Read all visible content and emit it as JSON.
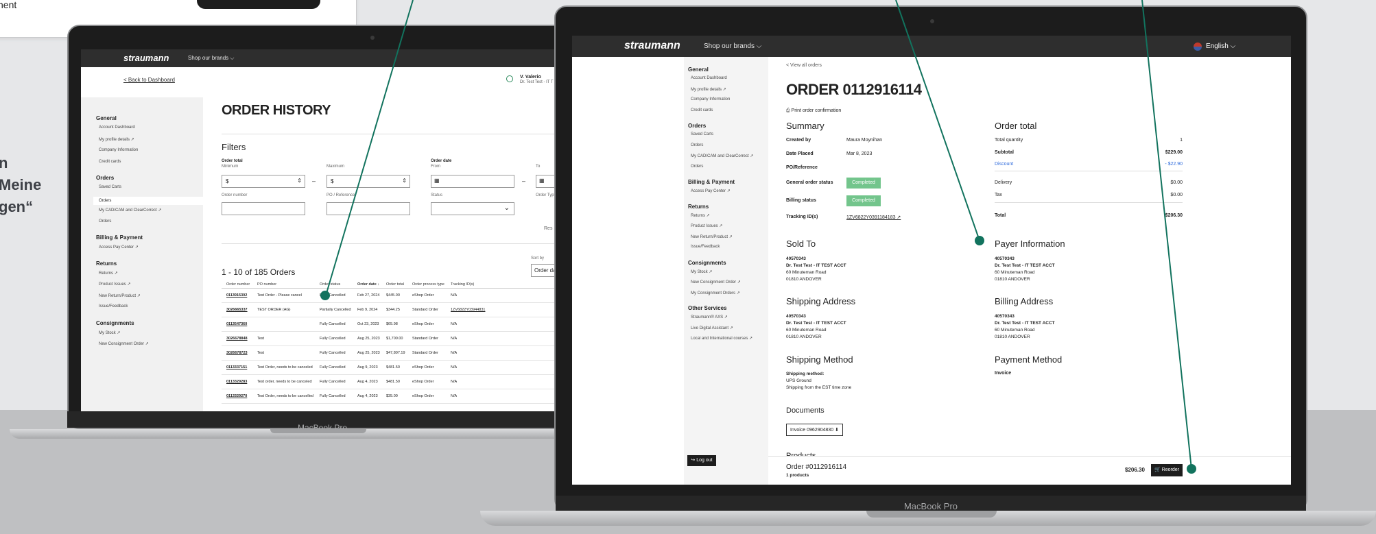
{
  "tooltip": {
    "label": "Payment"
  },
  "side_text": {
    "line1": "n",
    "line2": "Meine",
    "line3": "gen“"
  },
  "laptop_label": "MacBook Pro",
  "topbar": {
    "brand": "straumann",
    "brands": "Shop our brands ⌵",
    "language": "English ⌵"
  },
  "left": {
    "back": "< Back to Dashboard",
    "user_name": "V. Valerio",
    "user_sub": "Dr. Test Test - IT T",
    "title": "ORDER HISTORY",
    "filters": "Filters",
    "order_total": "Order total",
    "minimum": "Minimum",
    "maximum": "Maximum",
    "currency": "$",
    "dash": "–",
    "order_date": "Order date",
    "from": "From",
    "to": "To",
    "order_number": "Order number",
    "po_ref": "PO / Reference",
    "status": "Status",
    "order_type": "Order Typ",
    "reset": "Res",
    "count": "1 - 10 of 185 Orders",
    "sort_by": "Sort by",
    "sort_val": "Order da",
    "headers": [
      "Order number",
      "PO number",
      "Order status",
      "Order date ↓",
      "Order total",
      "Order process type",
      "Tracking ID(s)"
    ],
    "rows": [
      [
        "0113915302",
        "Test Order - Please cancel",
        "Fully Cancelled",
        "Feb 27, 2024",
        "$445.00",
        "eShop Order",
        "N/A"
      ],
      [
        "3026665337",
        "TEST ORDER (AG)",
        "Partially Cancelled",
        "Feb 9, 2024",
        "$344.25",
        "Standard Order",
        "1ZV6822Y03944831"
      ],
      [
        "0113547360",
        "",
        "Fully Cancelled",
        "Oct 23, 2023",
        "$65.98",
        "eShop Order",
        "N/A"
      ],
      [
        "3026678848",
        "Test",
        "Fully Cancelled",
        "Aug 25, 2023",
        "$1,700.00",
        "Standard Order",
        "N/A"
      ],
      [
        "3026678723",
        "Test",
        "Fully Cancelled",
        "Aug 25, 2023",
        "$47,807.19",
        "Standard Order",
        "N/A"
      ],
      [
        "0113337151",
        "Test Order, needs to be canceled",
        "Fully Cancelled",
        "Aug 9, 2023",
        "$481.50",
        "eShop Order",
        "N/A"
      ],
      [
        "0113329283",
        "Test order, needs to be canceled",
        "Fully Cancelled",
        "Aug 4, 2023",
        "$481.50",
        "eShop Order",
        "N/A"
      ],
      [
        "0113329270",
        "Test Order, needs to be cancelled",
        "Fully Cancelled",
        "Aug 4, 2023",
        "$35.00",
        "eShop Order",
        "N/A"
      ]
    ],
    "sidebar": [
      {
        "type": "h",
        "label": "General"
      },
      {
        "type": "i",
        "label": "Account Dashboard"
      },
      {
        "type": "i",
        "label": "My profile details ↗"
      },
      {
        "type": "i",
        "label": "Company Information"
      },
      {
        "type": "i",
        "label": "Credit cards"
      },
      {
        "type": "h",
        "label": "Orders"
      },
      {
        "type": "i",
        "label": "Saved Carts"
      },
      {
        "type": "a",
        "label": "Orders"
      },
      {
        "type": "i",
        "label": "My CAD/CAM and ClearCorrect ↗"
      },
      {
        "type": "i",
        "label": "Orders"
      },
      {
        "type": "h",
        "label": "Billing & Payment"
      },
      {
        "type": "i",
        "label": "Access Pay Center ↗"
      },
      {
        "type": "h",
        "label": "Returns"
      },
      {
        "type": "i",
        "label": "Returns ↗"
      },
      {
        "type": "i",
        "label": "Product Issues ↗"
      },
      {
        "type": "i",
        "label": "New Return/Product ↗"
      },
      {
        "type": "i",
        "label": "Issue/Feedback"
      },
      {
        "type": "h",
        "label": "Consignments"
      },
      {
        "type": "i",
        "label": "My Stock ↗"
      },
      {
        "type": "i",
        "label": "New Consignment Order ↗"
      }
    ]
  },
  "right": {
    "view_all": "< View all orders",
    "title": "ORDER 0112916114",
    "print": "⎙ Print order confirmation",
    "summary": "Summary",
    "created_by_l": "Created by",
    "created_by_v": "Maura Moynihan",
    "date_l": "Date Placed",
    "date_v": "Mar 8, 2023",
    "po_l": "PO/Reference",
    "gen_status_l": "General order status",
    "gen_status_v": "Completed",
    "bill_status_l": "Billing status",
    "bill_status_v": "Completed",
    "tracking_l": "Tracking ID(s)",
    "tracking_v": "1ZV6822Y0391184183 ↗",
    "order_total": "Order total",
    "tq_l": "Total quantity",
    "tq_v": "1",
    "sub_l": "Subtotal",
    "sub_v": "$229.00",
    "disc_l": "Discount",
    "disc_v": "- $22.90",
    "del_l": "Delivery",
    "del_v": "$0.00",
    "tax_l": "Tax",
    "tax_v": "$0.00",
    "total_l": "Total",
    "total_v": "$206.30",
    "sold_to": "Sold To",
    "payer": "Payer Information",
    "ship_addr": "Shipping Address",
    "bill_addr": "Billing Address",
    "addr_id": "40570343",
    "addr_name": "Dr. Test Test - IT TEST ACCT",
    "addr_street": "60 Minuteman Road",
    "addr_city": "01810 ANDOVER",
    "ship_method": "Shipping Method",
    "ship_method_l": "Shipping method:",
    "ship_method_v1": "UPS Ground",
    "ship_method_v2": "Shipping from the EST time zone",
    "pay_method": "Payment Method",
    "pay_method_v": "Invoice",
    "documents": "Documents",
    "invoice": "Invoice 0962904830 ⬇",
    "products": "Products",
    "footer_order": "Order #0112916114",
    "footer_count": "1 products",
    "footer_total": "$206.30",
    "reorder": "🛒 Reorder",
    "logout": "↪ Log out",
    "sidebar": [
      {
        "type": "h",
        "label": "General"
      },
      {
        "type": "i",
        "label": "Account Dashboard"
      },
      {
        "type": "i",
        "label": "My profile details ↗"
      },
      {
        "type": "i",
        "label": "Company Information"
      },
      {
        "type": "i",
        "label": "Credit cards"
      },
      {
        "type": "h",
        "label": "Orders"
      },
      {
        "type": "i",
        "label": "Saved Carts"
      },
      {
        "type": "i",
        "label": "Orders"
      },
      {
        "type": "i",
        "label": "My CAD/CAM and ClearCorrect ↗"
      },
      {
        "type": "i",
        "label": "Orders"
      },
      {
        "type": "h",
        "label": "Billing & Payment"
      },
      {
        "type": "i",
        "label": "Access Pay Center ↗"
      },
      {
        "type": "h",
        "label": "Returns"
      },
      {
        "type": "i",
        "label": "Returns ↗"
      },
      {
        "type": "i",
        "label": "Product Issues ↗"
      },
      {
        "type": "i",
        "label": "New Return/Product ↗"
      },
      {
        "type": "i",
        "label": "Issue/Feedback"
      },
      {
        "type": "h",
        "label": "Consignments"
      },
      {
        "type": "i",
        "label": "My Stock ↗"
      },
      {
        "type": "i",
        "label": "New Consignment Order ↗"
      },
      {
        "type": "i",
        "label": "My Consignment Orders ↗"
      },
      {
        "type": "h",
        "label": "Other Services"
      },
      {
        "type": "i",
        "label": "Straumann® AXS ↗"
      },
      {
        "type": "i",
        "label": "Live Digital Assistant ↗"
      },
      {
        "type": "i",
        "label": "Local and International courses ↗"
      }
    ]
  }
}
